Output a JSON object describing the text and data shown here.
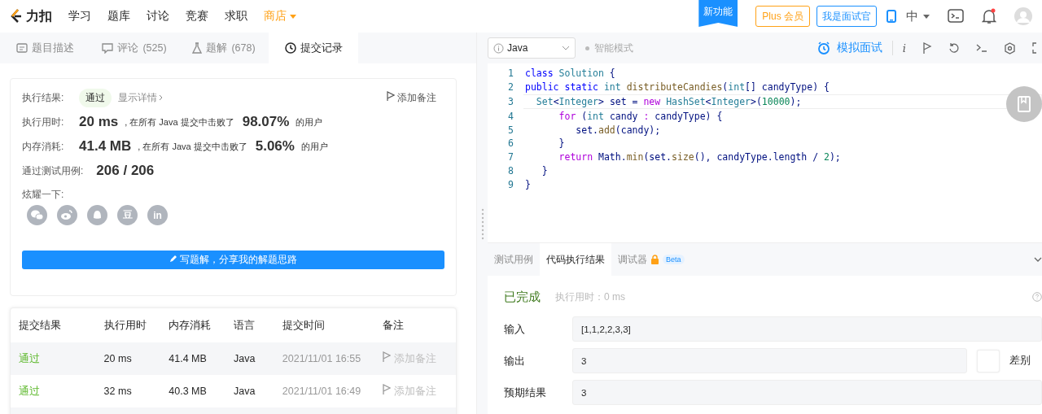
{
  "nav": {
    "logo_text": "力扣",
    "items": [
      "学习",
      "题库",
      "讨论",
      "竞赛",
      "求职"
    ],
    "shop": "商店",
    "new_feature": "新功能",
    "plus": "Plus 会员",
    "interviewer": "我是面试官",
    "language": "中"
  },
  "left_tabs": [
    {
      "label": "题目描述",
      "selected": false
    },
    {
      "label": "评论",
      "count": "(525)",
      "selected": false
    },
    {
      "label": "题解",
      "count": "(678)",
      "selected": false
    },
    {
      "label": "提交记录",
      "selected": true
    }
  ],
  "editor_toolbar": {
    "language": "Java",
    "smart_mode": "智能模式",
    "mock_interview": "模拟面试",
    "info": "i"
  },
  "result": {
    "label": "执行结果:",
    "status": "通过",
    "details": "显示详情",
    "add_note": "添加备注"
  },
  "stats": [
    {
      "label": "执行用时:",
      "value": "20 ms",
      "text": ", 在所有 Java 提交中击败了",
      "percent": "98.07%",
      "suffix": "的用户"
    },
    {
      "label": "内存消耗:",
      "value": "41.4 MB",
      "text": ", 在所有 Java 提交中击败了",
      "percent": "5.06%",
      "suffix": "的用户"
    }
  ],
  "tests": {
    "label": "通过测试用例:",
    "value": "206 / 206"
  },
  "share": {
    "label": "炫耀一下:",
    "buttons": [
      {
        "kind": "wechat"
      },
      {
        "kind": "weibo"
      },
      {
        "kind": "qq"
      },
      {
        "kind": "text",
        "label": "豆"
      },
      {
        "kind": "text",
        "label": "in"
      }
    ]
  },
  "write_solution": "写题解，分享我的解题思路",
  "submissions": {
    "columns": [
      "提交结果",
      "执行用时",
      "内存消耗",
      "语言",
      "提交时间",
      "备注"
    ],
    "rows": [
      {
        "status": "通过",
        "runtime": "20 ms",
        "memory": "41.4 MB",
        "language": "Java",
        "time": "2021/11/01 16:55",
        "note": "添加备注"
      },
      {
        "status": "通过",
        "runtime": "32 ms",
        "memory": "40.3 MB",
        "language": "Java",
        "time": "2021/11/01 16:49",
        "note": "添加备注"
      }
    ]
  },
  "code": [
    {
      "number": "1",
      "current": false,
      "tokens": [
        {
          "kind": "kw",
          "text": "class"
        },
        {
          "kind": "type",
          "text": " Solution"
        },
        {
          "kind": "plain",
          "text": " {"
        }
      ]
    },
    {
      "number": "2",
      "current": false,
      "tokens": [
        {
          "kind": "kw",
          "text": "public static"
        },
        {
          "kind": "type",
          "text": " int"
        },
        {
          "kind": "fn",
          "text": " distributeCandies"
        },
        {
          "kind": "plain",
          "text": "("
        },
        {
          "kind": "type",
          "text": "int"
        },
        {
          "kind": "plain",
          "text": "[] candyType) {"
        }
      ]
    },
    {
      "number": "3",
      "current": true,
      "tokens": [
        {
          "kind": "type",
          "text": "  Set"
        },
        {
          "kind": "plain",
          "text": "<"
        },
        {
          "kind": "type",
          "text": "Integer"
        },
        {
          "kind": "plain",
          "text": "> set = "
        },
        {
          "kind": "ctl",
          "text": "new"
        },
        {
          "kind": "type",
          "text": " HashSet"
        },
        {
          "kind": "plain",
          "text": "<"
        },
        {
          "kind": "type",
          "text": "Integer"
        },
        {
          "kind": "plain",
          "text": ">("
        },
        {
          "kind": "num",
          "text": "10000"
        },
        {
          "kind": "plain",
          "text": ");"
        }
      ]
    },
    {
      "number": "4",
      "current": false,
      "tokens": [
        {
          "kind": "ctl",
          "text": "      for"
        },
        {
          "kind": "plain",
          "text": " ("
        },
        {
          "kind": "type",
          "text": "int"
        },
        {
          "kind": "plain",
          "text": " candy "
        },
        {
          "kind": "ctl",
          "text": ":"
        },
        {
          "kind": "plain",
          "text": " candyType) {"
        }
      ]
    },
    {
      "number": "5",
      "current": false,
      "tokens": [
        {
          "kind": "plain",
          "text": "         set."
        },
        {
          "kind": "fn",
          "text": "add"
        },
        {
          "kind": "plain",
          "text": "(candy);"
        }
      ]
    },
    {
      "number": "6",
      "current": false,
      "tokens": [
        {
          "kind": "plain",
          "text": "      }"
        }
      ]
    },
    {
      "number": "7",
      "current": false,
      "tokens": [
        {
          "kind": "ctl",
          "text": "      return"
        },
        {
          "kind": "plain",
          "text": " Math."
        },
        {
          "kind": "fn",
          "text": "min"
        },
        {
          "kind": "plain",
          "text": "(set."
        },
        {
          "kind": "fn",
          "text": "size"
        },
        {
          "kind": "plain",
          "text": "(), candyType.length / "
        },
        {
          "kind": "num",
          "text": "2"
        },
        {
          "kind": "plain",
          "text": ");"
        }
      ]
    },
    {
      "number": "8",
      "current": false,
      "tokens": [
        {
          "kind": "plain",
          "text": "   }"
        }
      ]
    },
    {
      "number": "9",
      "current": false,
      "tokens": [
        {
          "kind": "plain",
          "text": "}"
        }
      ]
    }
  ],
  "bottom_tabs": [
    {
      "label": "测试用例",
      "selected": false,
      "locked": false
    },
    {
      "label": "代码执行结果",
      "selected": true,
      "locked": false
    },
    {
      "label": "调试器",
      "selected": false,
      "locked": true,
      "badge": "Beta"
    }
  ],
  "run_result": {
    "status": "已完成",
    "runtime": "执行用时：0 ms",
    "fields": [
      {
        "label": "输入",
        "value": "[1,1,2,2,3,3]"
      },
      {
        "label": "输出",
        "value": "3"
      },
      {
        "label": "预期结果",
        "value": "3"
      }
    ],
    "diff": {
      "label": "差别",
      "checked": false
    }
  }
}
